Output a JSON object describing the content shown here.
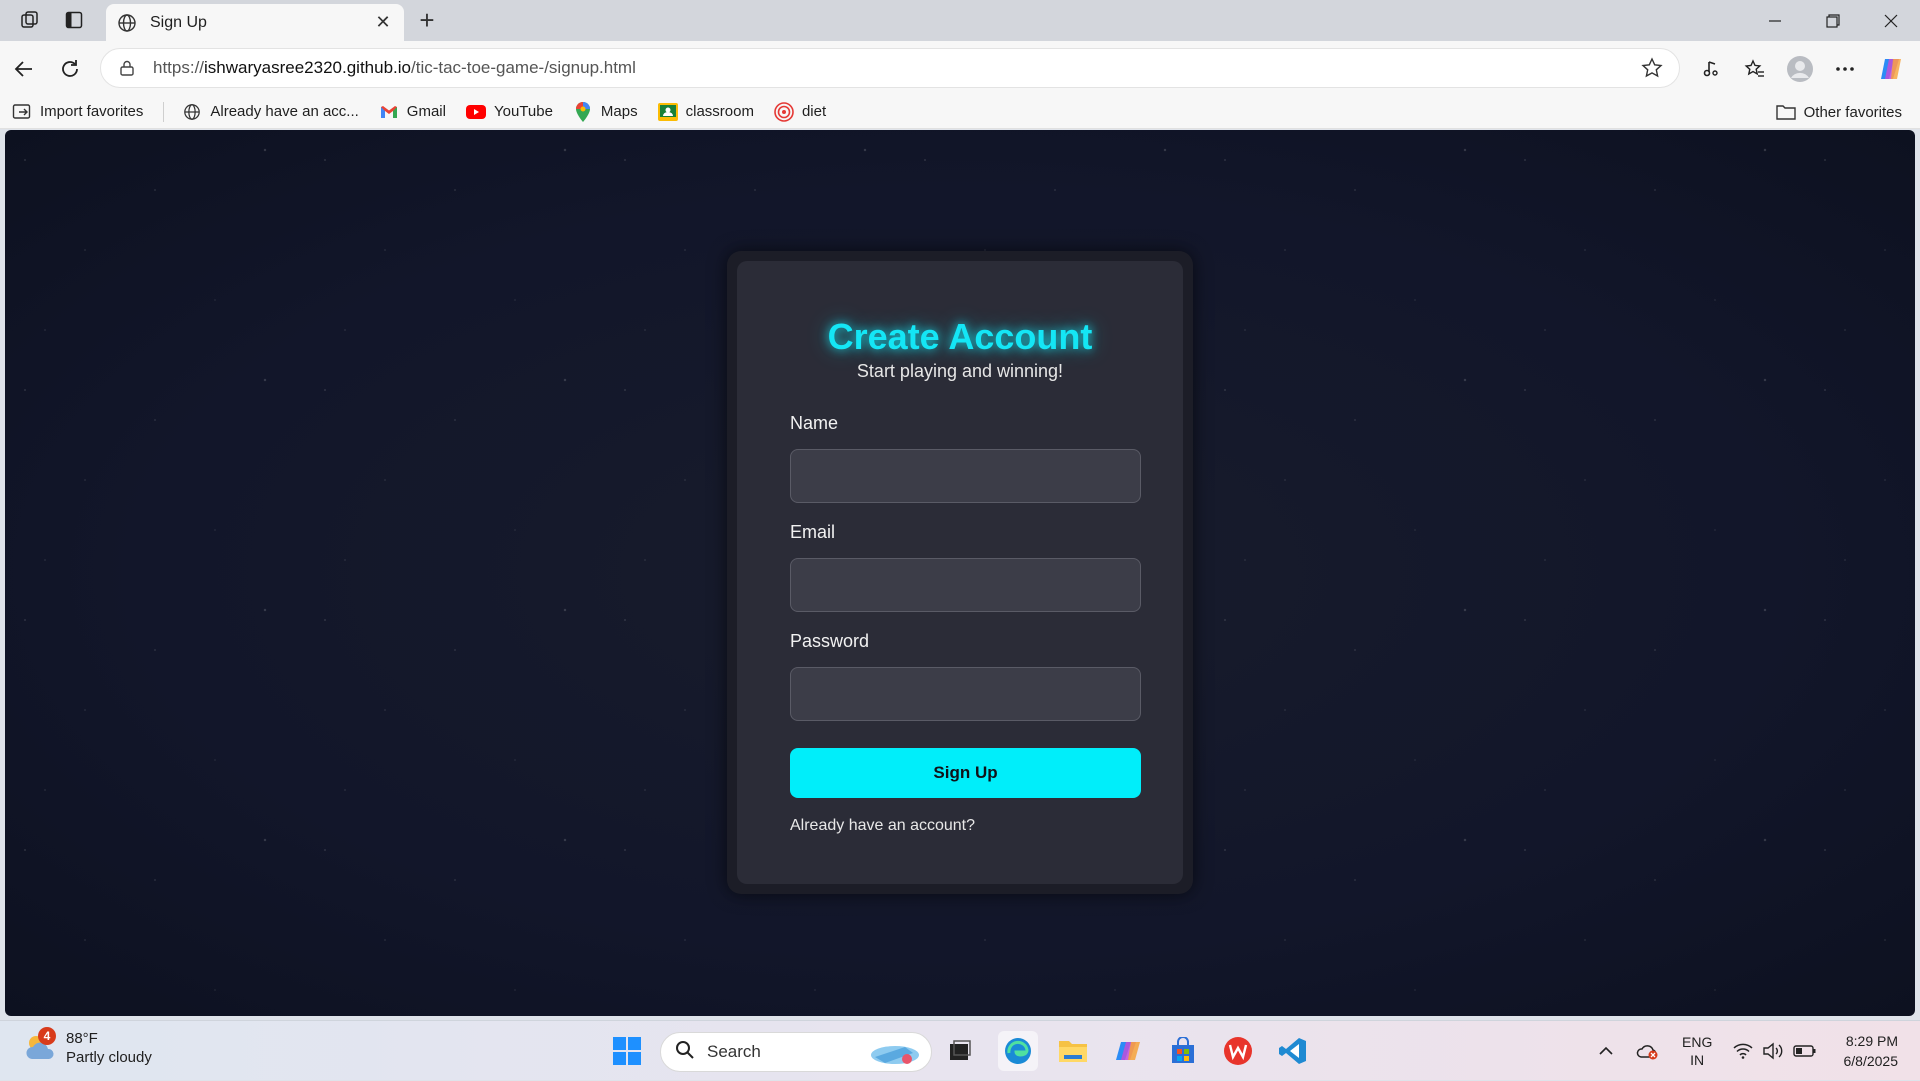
{
  "browser": {
    "tab_title": "Sign Up",
    "url_prefix": "https://",
    "url_host": "ishwaryasree2320.github.io",
    "url_path": "/tic-tac-toe-game-/signup.html",
    "bookmarks": [
      {
        "label": "Import favorites",
        "icon": "import-icon"
      },
      {
        "label": "Already have an acc...",
        "icon": "globe-icon"
      },
      {
        "label": "Gmail",
        "icon": "gmail-icon"
      },
      {
        "label": "YouTube",
        "icon": "youtube-icon"
      },
      {
        "label": "Maps",
        "icon": "maps-icon"
      },
      {
        "label": "classroom",
        "icon": "classroom-icon"
      },
      {
        "label": "diet",
        "icon": "diet-icon"
      }
    ],
    "other_favorites": "Other favorites"
  },
  "page": {
    "title": "Create Account",
    "subtitle": "Start playing and winning!",
    "name_label": "Name",
    "email_label": "Email",
    "password_label": "Password",
    "signup_button": "Sign Up",
    "login_link": "Already have an account?",
    "accent_color": "#00eefa"
  },
  "taskbar": {
    "weather_temp": "88°F",
    "weather_desc": "Partly cloudy",
    "weather_badge": "4",
    "search_placeholder": "Search",
    "lang_top": "ENG",
    "lang_bottom": "IN",
    "time": "8:29 PM",
    "date": "6/8/2025"
  }
}
